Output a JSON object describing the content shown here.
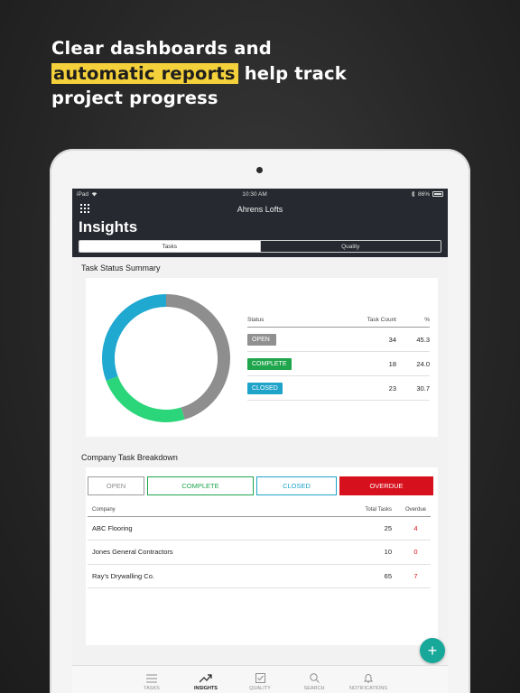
{
  "headline": {
    "line1": "Clear dashboards and",
    "line2_highlight": "automatic reports",
    "line2_rest": " help track",
    "line3": "project progress"
  },
  "status_bar": {
    "device": "iPad",
    "time": "10:30 AM",
    "battery": "86%"
  },
  "header": {
    "project_name": "Ahrens Lofts",
    "page_title": "Insights",
    "tabs": [
      {
        "label": "Tasks",
        "active": true
      },
      {
        "label": "Quality",
        "active": false
      }
    ]
  },
  "task_status_summary": {
    "title": "Task Status Summary",
    "columns": [
      "Status",
      "Task Count",
      "%"
    ],
    "rows": [
      {
        "status": "OPEN",
        "count": "34",
        "percent": "45.3",
        "color": "#909090"
      },
      {
        "status": "COMPLETE",
        "count": "18",
        "percent": "24.0",
        "color": "#2bd67a"
      },
      {
        "status": "CLOSED",
        "count": "23",
        "percent": "30.7",
        "color": "#1fa8d0"
      }
    ]
  },
  "chart_data": {
    "type": "pie",
    "categories": [
      "OPEN",
      "COMPLETE",
      "CLOSED"
    ],
    "values": [
      45.3,
      24.0,
      30.7
    ],
    "counts": [
      34,
      18,
      23
    ],
    "colors": [
      "#8e8e8e",
      "#2bd67a",
      "#1fa8d0"
    ],
    "title": "Task Status Summary"
  },
  "company_breakdown": {
    "title": "Company Task Breakdown",
    "filters": [
      "OPEN",
      "COMPLETE",
      "CLOSED",
      "OVERDUE"
    ],
    "columns": [
      "Company",
      "Total Tasks",
      "Overdue"
    ],
    "rows": [
      {
        "company": "ABC Flooring",
        "total": "25",
        "overdue": "4"
      },
      {
        "company": "Jones General Contractors",
        "total": "10",
        "overdue": "0"
      },
      {
        "company": "Ray's Drywalling Co.",
        "total": "65",
        "overdue": "7"
      }
    ]
  },
  "fab": {
    "icon": "plus-icon",
    "label": "+"
  },
  "tabbar": [
    {
      "label": "TASKS",
      "icon": "list-icon",
      "active": false
    },
    {
      "label": "INSIGHTS",
      "icon": "trend-icon",
      "active": true
    },
    {
      "label": "QUALITY",
      "icon": "checkbox-icon",
      "active": false
    },
    {
      "label": "SEARCH",
      "icon": "search-icon",
      "active": false
    },
    {
      "label": "NOTIFICATIONS",
      "icon": "bell-icon",
      "active": false
    }
  ],
  "colors": {
    "accent_highlight": "#f4d03a",
    "header_bg": "#262a30",
    "overdue_red": "#d6111d",
    "fab_teal": "#18a89a"
  }
}
